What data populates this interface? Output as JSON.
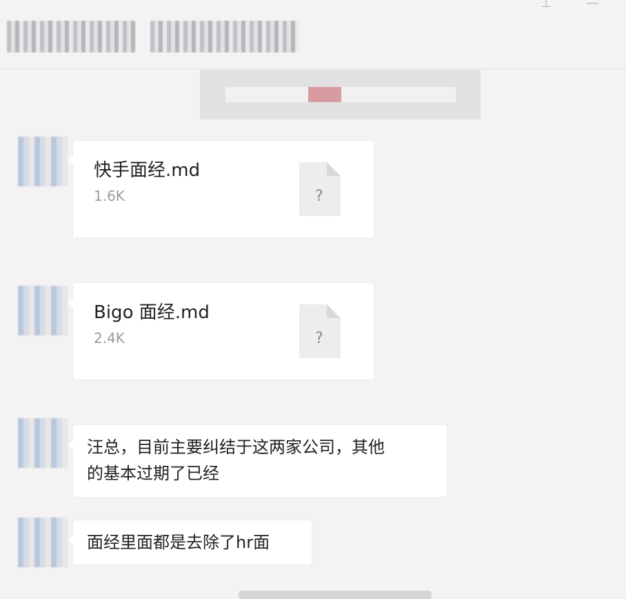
{
  "header": {
    "icons": [
      "pin-icon",
      "minimize-icon"
    ]
  },
  "messages": [
    {
      "type": "file",
      "name": "快手面经.md",
      "size": "1.6K",
      "icon_glyph": "?"
    },
    {
      "type": "file",
      "name": "Bigo 面经.md",
      "size": "2.4K",
      "icon_glyph": "?"
    },
    {
      "type": "text",
      "lines": [
        "汪总，目前主要纠结于这两家公司，其他",
        "的基本过期了已经"
      ]
    },
    {
      "type": "text",
      "lines": [
        "面经里面都是去除了hr面"
      ]
    }
  ],
  "colors": {
    "background": "#f3f3f3",
    "bubble": "#ffffff",
    "file_icon": "#ededed",
    "file_icon_fold": "#d9d9d9",
    "notice_accent": "#d79ba0"
  }
}
